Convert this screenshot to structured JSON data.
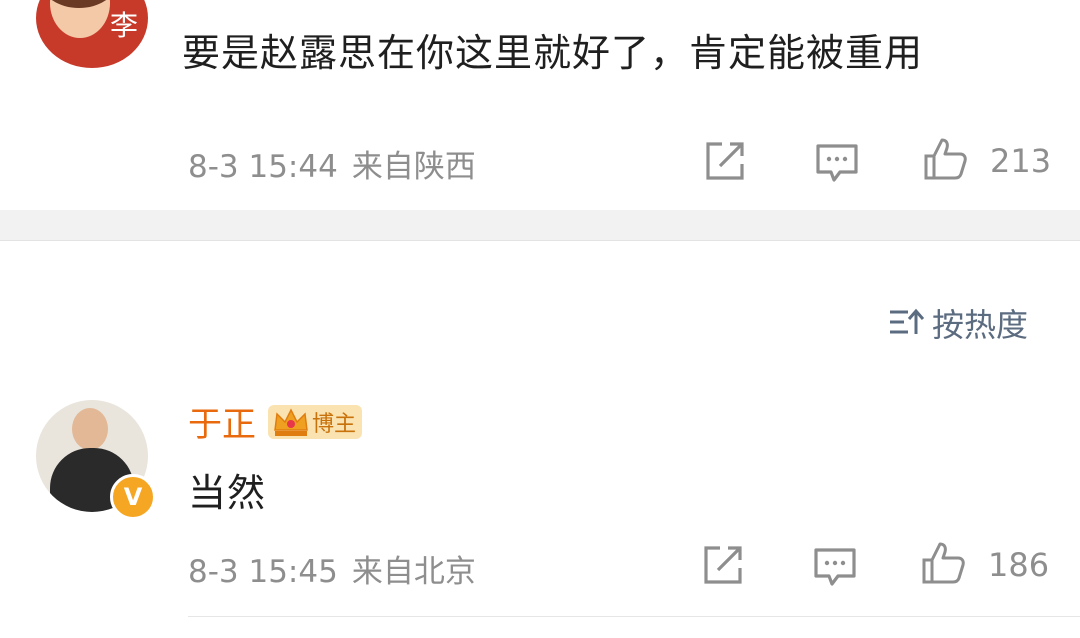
{
  "comment1": {
    "avatar_text": "李",
    "text": "要是赵露思在你这里就好了，肯定能被重用",
    "date": "8-3 15:44",
    "location": "来自陕西",
    "likes": "213"
  },
  "sort": {
    "label": "按热度"
  },
  "comment2": {
    "username": "于正",
    "badge": "博主",
    "verified_mark": "V",
    "text": "当然",
    "date": "8-3 15:45",
    "location": "来自北京",
    "likes": "186"
  },
  "colors": {
    "username": "#e86a0c",
    "meta": "#8e8e8e",
    "badge_bg": "#fbe3b1",
    "verified": "#f5a623",
    "sort": "#5b6b80"
  },
  "icons": [
    "share-icon",
    "comment-icon",
    "like-icon",
    "sort-icon",
    "crown-icon"
  ]
}
